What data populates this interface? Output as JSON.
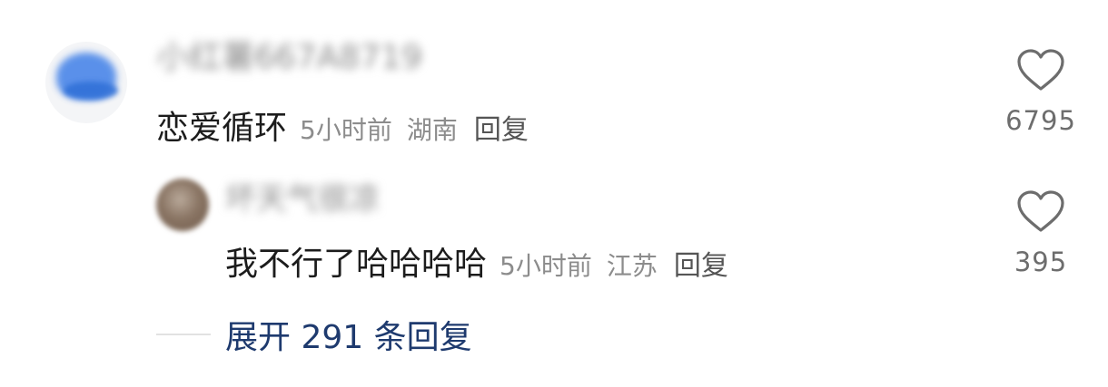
{
  "comment": {
    "username": "小红薯667A8719",
    "text": "恋爱循环",
    "time": "5小时前",
    "location": "湖南",
    "reply_label": "回复",
    "likes": "6795"
  },
  "reply": {
    "username": "坏天气很凉",
    "text": "我不行了哈哈哈哈",
    "time": "5小时前",
    "location": "江苏",
    "reply_label": "回复",
    "likes": "395"
  },
  "expand": {
    "label": "展开 291 条回复"
  },
  "colors": {
    "accent_link": "#1e3a6e",
    "meta_gray": "#8c8c8c",
    "heart_stroke": "#6d6d6d"
  },
  "icons": {
    "like": "heart-outline-icon"
  }
}
